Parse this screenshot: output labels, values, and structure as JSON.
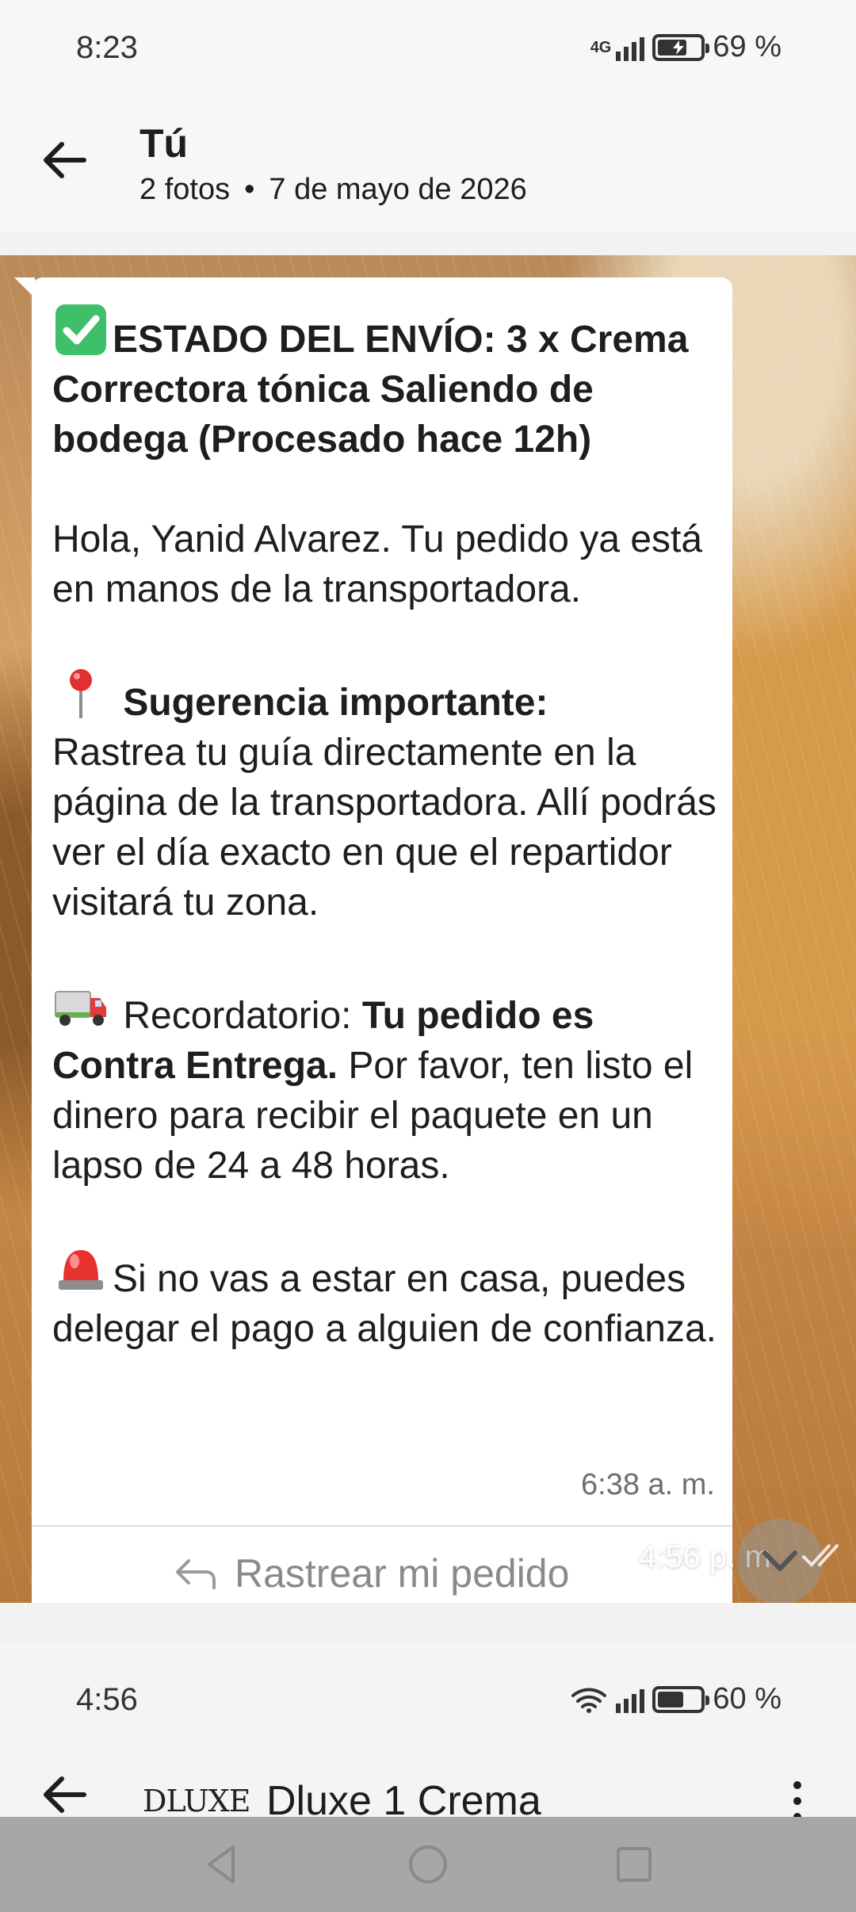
{
  "status_bar": {
    "time": "8:23",
    "network": "4G",
    "battery": "69 %",
    "battery_level": 0.69
  },
  "header": {
    "title": "Tú",
    "photo_count": "2 fotos",
    "separator": "•",
    "date": "7 de mayo de 2026"
  },
  "message": {
    "line1": "ESTADO DEL ENVÍO: 3 x Crema Correctora tónica Saliendo de bodega (Procesado hace 12h)",
    "greeting": "Hola, Yanid Alvarez. Tu pedido ya está en manos de la transportadora.",
    "suggestion_title": "Sugerencia importante:",
    "suggestion_body": "Rastrea tu guía directamente en la página de la transportadora. Allí podrás ver el día exacto en que el repartidor visitará tu zona.",
    "reminder_label": "Recordatorio:",
    "reminder_bold": "Tu pedido es Contra Entrega.",
    "reminder_body": " Por favor, ten listo el dinero para recibir el paquete en un lapso de 24 a 48 horas.",
    "alert_text": "Si no vas a estar en casa, puedes delegar el pago a alguien de confianza.",
    "timestamp": "6:38 a. m.",
    "button_label": "Rastrear mi pedido",
    "icons": [
      "check-mark-emoji-icon",
      "round-pushpin-emoji-icon",
      "truck-emoji-icon",
      "police-light-emoji-icon"
    ]
  },
  "overlay": {
    "time": "4:56 p. m."
  },
  "lower_screenshot": {
    "time": "4:56",
    "battery": "60 %",
    "battery_level": 0.6,
    "logo_text": "DLUXE",
    "chat_name": "Dluxe 1 Crema"
  },
  "colors": {
    "status_bg": "#f7f7f7",
    "bubble": "#ffffff",
    "navbar": "#a7a7a7",
    "check_green": "#3fbf6a"
  }
}
